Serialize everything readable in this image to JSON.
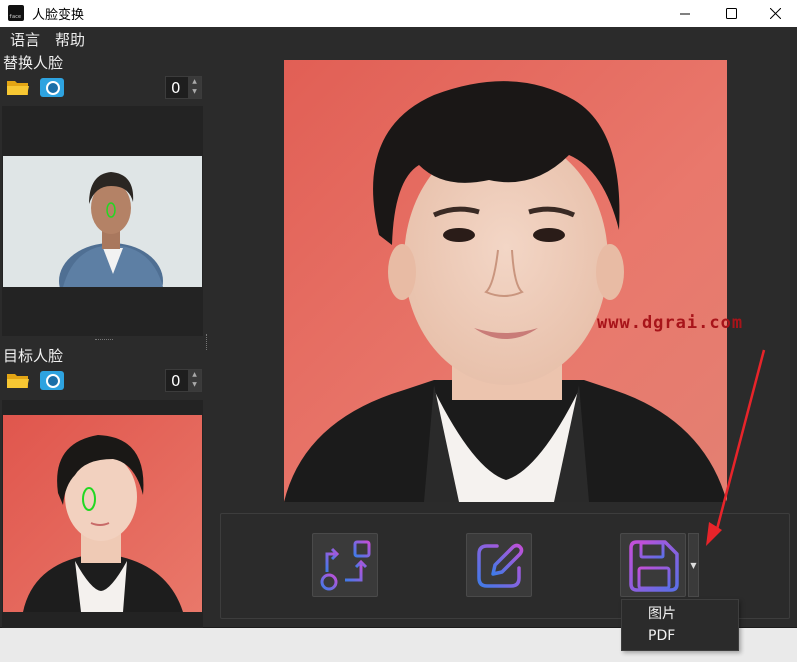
{
  "window": {
    "title": "人脸变换",
    "icon_text": "face",
    "controls": [
      "minimize-icon",
      "maximize-icon",
      "close-icon"
    ]
  },
  "menu": {
    "items": [
      "语言",
      "帮助"
    ]
  },
  "source_face": {
    "title": "替换人脸",
    "count": "0",
    "icons": [
      "folder-icon",
      "camera-icon"
    ]
  },
  "target_face": {
    "title": "目标人脸",
    "count": "0",
    "icons": [
      "folder-icon",
      "camera-icon"
    ]
  },
  "toolbar": {
    "buttons": [
      "swap-icon",
      "edit-icon",
      "save-icon"
    ],
    "save_menu": [
      "图片",
      "PDF"
    ]
  },
  "watermark": "www.dgrai.com",
  "colors": {
    "window_bg": "#2b2b2b",
    "panel_bg": "#232323",
    "accent_gradient_start": "#3f7be8",
    "accent_gradient_end": "#c34fd8",
    "watermark": "#a8141a",
    "annotation_arrow": "#e8242a",
    "face_marker": "#22d822"
  }
}
